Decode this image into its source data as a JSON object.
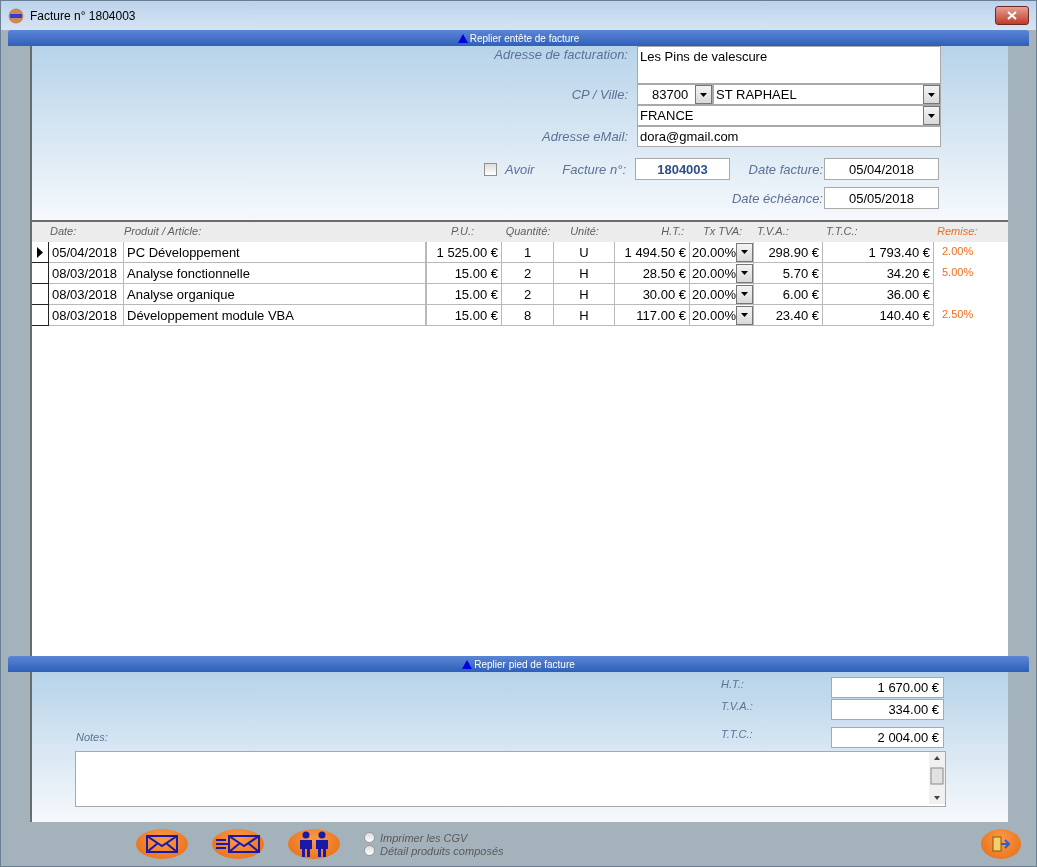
{
  "window": {
    "title": "Facture n° 1804003"
  },
  "header_bar": {
    "label": "Replier entête de facture"
  },
  "header": {
    "address_label": "Adresse de facturation:",
    "address": "Les Pins de valescure",
    "cp_label": "CP / Ville:",
    "postal_code": "83700",
    "city": "ST RAPHAEL",
    "country": "FRANCE",
    "email_label": "Adresse eMail:",
    "email": "dora@gmail.com",
    "avoir": {
      "label": "Avoir",
      "checked": false
    },
    "invoice_no_label": "Facture n°:",
    "invoice_no": "1804003",
    "date_label": "Date facture:",
    "date": "05/04/2018",
    "due_label": "Date échéance:",
    "due_date": "05/05/2018"
  },
  "table": {
    "columns": [
      "Date:",
      "Produit / Article:",
      "P.U.:",
      "Quantité:",
      "Unité:",
      "H.T.:",
      "Tx TVA:",
      "T.V.A.:",
      "T.T.C.:",
      "Remise:"
    ],
    "rows": [
      {
        "selected": true,
        "date": "05/04/2018",
        "product": "PC Développement",
        "unit_price": "1 525.00 €",
        "quantity": "1",
        "unit": "U",
        "ht": "1 494.50 €",
        "vat_rate": "20.00%",
        "vat": "298.90 €",
        "ttc": "1 793.40 €",
        "discount": "2.00%"
      },
      {
        "selected": false,
        "date": "08/03/2018",
        "product": "Analyse fonctionnelle",
        "unit_price": "15.00 €",
        "quantity": "2",
        "unit": "H",
        "ht": "28.50 €",
        "vat_rate": "20.00%",
        "vat": "5.70 €",
        "ttc": "34.20 €",
        "discount": "5.00%"
      },
      {
        "selected": false,
        "date": "08/03/2018",
        "product": "Analyse organique",
        "unit_price": "15.00 €",
        "quantity": "2",
        "unit": "H",
        "ht": "30.00 €",
        "vat_rate": "20.00%",
        "vat": "6.00 €",
        "ttc": "36.00 €"
      },
      {
        "selected": false,
        "date": "08/03/2018",
        "product": "Développement module VBA",
        "unit_price": "15.00 €",
        "quantity": "8",
        "unit": "H",
        "ht": "117.00 €",
        "vat_rate": "20.00%",
        "vat": "23.40 €",
        "ttc": "140.40 €",
        "discount": "2.50%"
      }
    ]
  },
  "footer_bar": {
    "label": "Replier pied de facture"
  },
  "totals": [
    {
      "label": "H.T.:",
      "value": "1 670.00 €"
    },
    {
      "label": "T.V.A.:",
      "value": "334.00 €"
    },
    {
      "label": "T.T.C.:",
      "value": "2 004.00 €"
    }
  ],
  "notes": {
    "label": "Notes:"
  },
  "options": [
    {
      "label": "Imprimer les CGV",
      "selected": false
    },
    {
      "label": "Détail produits composés",
      "selected": false
    }
  ]
}
